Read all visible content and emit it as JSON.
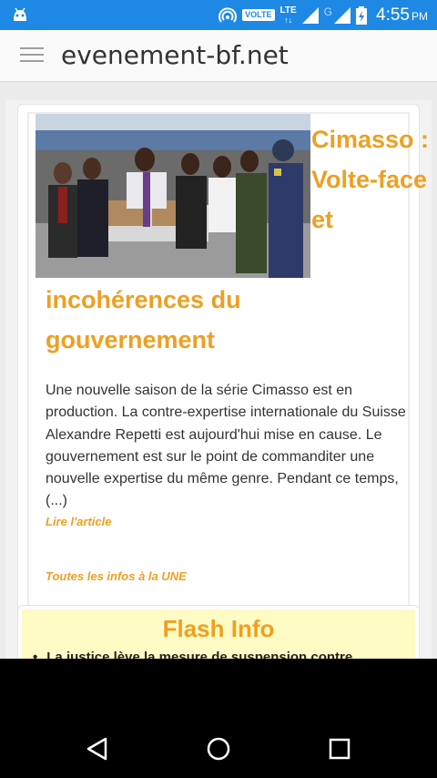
{
  "status_bar": {
    "volte_label": "VOLTE",
    "lte_label": "LTE",
    "g_label": "G",
    "time": "4:55",
    "ampm": "PM",
    "color": "#1e88e5"
  },
  "app_bar": {
    "site_title": "evenement-bf.net"
  },
  "article": {
    "headline_part1": "Cimasso : Volte-face et",
    "headline_part2": "incohérences du gouvernement",
    "excerpt": "Une nouvelle saison de la série Cimasso est en production. La contre-expertise internationale du Suisse Alexandre Repetti est aujourd'hui mise en cause. Le gouvernement est sur le point de commanditer une nouvelle expertise du même genre. Pendant ce temps, (...)",
    "read_link": "Lire l'article",
    "all_link": "Toutes les infos à la UNE",
    "accent_color": "#eea021"
  },
  "flash": {
    "title": "Flash Info",
    "item": "La justice lève la mesure de suspension contre"
  },
  "nav_bar": {
    "back_icon": "back-triangle-icon",
    "home_icon": "home-circle-icon",
    "recents_icon": "recents-square-icon"
  }
}
